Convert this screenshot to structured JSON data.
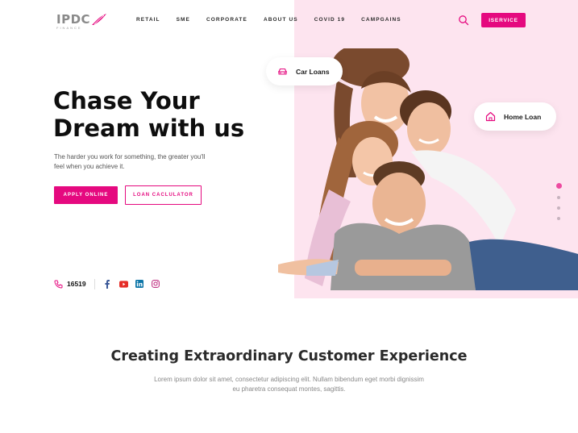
{
  "brand": {
    "name": "IPDC",
    "tagline": "FINANCE",
    "accent": "#e5097f",
    "pink_bg": "#fde4ef"
  },
  "nav": {
    "items": [
      "RETAIL",
      "SME",
      "CORPORATE",
      "ABOUT US",
      "COVID 19",
      "CAMPGAINS"
    ]
  },
  "header": {
    "search_icon": "search-icon",
    "iservice_label": "ISERVICE"
  },
  "hero": {
    "title_line1": "Chase Your",
    "title_line2": "Dream with us",
    "subtitle": "The harder you work for something, the greater you'll feel when you achieve it.",
    "apply_label": "APPLY ONLINE",
    "calculator_label": "LOAN CACLULATOR"
  },
  "contact": {
    "phone_icon": "phone-icon",
    "phone": "16519",
    "social": [
      "facebook-icon",
      "youtube-icon",
      "linkedin-icon",
      "instagram-icon"
    ]
  },
  "cards": {
    "car": "Car Loans",
    "home": "Home Loan"
  },
  "slider": {
    "dots": 4,
    "active": 0
  },
  "section": {
    "title": "Creating Extraordinary Customer Experience",
    "text": "Lorem ipsum dolor sit amet, consectetur adipiscing elit. Nullam bibendum eget morbi dignissim eu pharetra consequat montes, sagittis."
  }
}
